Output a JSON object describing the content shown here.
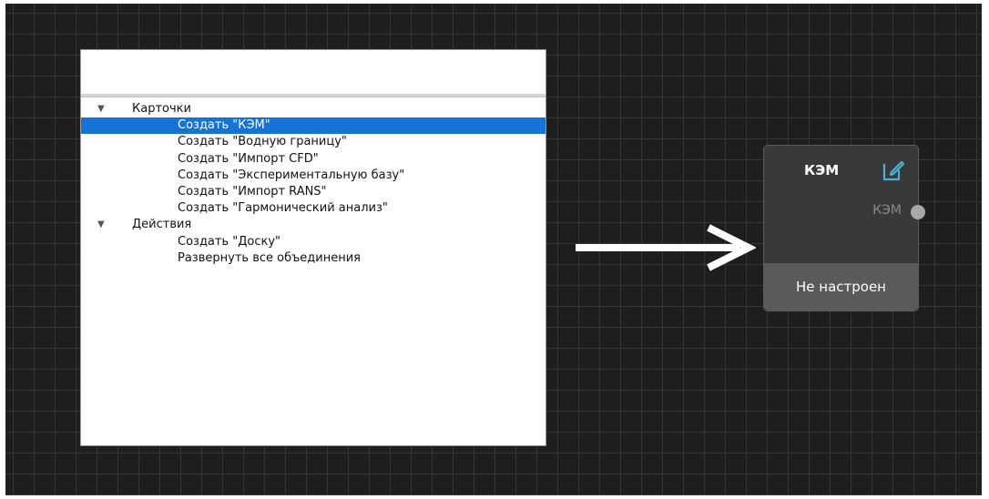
{
  "search": {
    "value": "",
    "placeholder": ""
  },
  "menu": {
    "groups": [
      {
        "label": "Карточки",
        "items": [
          {
            "label": "Создать \"КЭМ\"",
            "selected": true
          },
          {
            "label": "Создать \"Водную границу\""
          },
          {
            "label": "Создать \"Импорт CFD\""
          },
          {
            "label": "Создать \"Экспериментальную базу\""
          },
          {
            "label": "Создать \"Импорт RANS\""
          },
          {
            "label": "Создать \"Гармонический анализ\""
          }
        ]
      },
      {
        "label": "Действия",
        "items": [
          {
            "label": "Создать \"Доску\""
          },
          {
            "label": "Развернуть все объединения"
          }
        ]
      }
    ]
  },
  "node": {
    "title": "КЭМ",
    "port_label": "КЭМ",
    "status": "Не настроен",
    "edit_icon": "edit-icon",
    "accent": "#4fb1cf"
  },
  "colors": {
    "canvas_bg": "#1e1e1e",
    "grid": "#353535",
    "selection": "#1473d4"
  }
}
